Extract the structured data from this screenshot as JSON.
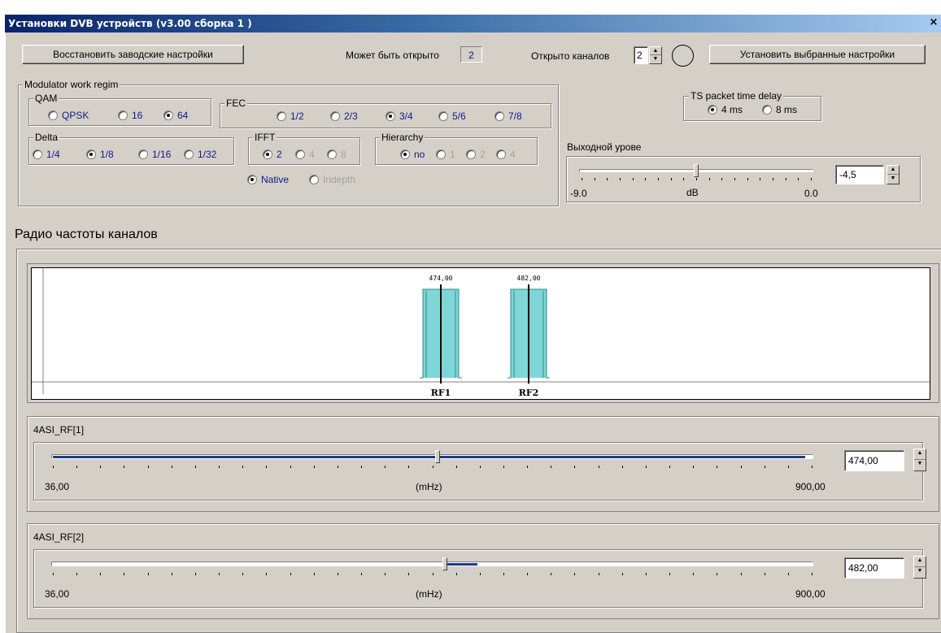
{
  "window": {
    "title": "Установки DVB устройств (v3.00 сборка  1 )",
    "close_glyph": "×"
  },
  "top": {
    "restore_button": "Восстановить заводские настройки",
    "can_open_label": "Может быть открыто",
    "can_open_value": "2",
    "opened_label": "Открыто каналов",
    "opened_value": "2",
    "apply_button": "Установить выбранные настройки"
  },
  "modulator": {
    "title": "Modulator work regim",
    "qam": {
      "title": "QAM",
      "options": [
        "QPSK",
        "16",
        "64"
      ],
      "selected": "64"
    },
    "fec": {
      "title": "FEC",
      "options": [
        "1/2",
        "2/3",
        "3/4",
        "5/6",
        "7/8"
      ],
      "selected": "3/4"
    },
    "delta": {
      "title": "Delta",
      "options": [
        "1/4",
        "1/8",
        "1/16",
        "1/32"
      ],
      "selected": "1/8"
    },
    "ifft": {
      "title": "IFFT",
      "options": [
        "2",
        "4",
        "8"
      ],
      "selected": "2"
    },
    "hierarchy": {
      "title": "Hierarchy",
      "options": [
        "no",
        "1",
        "2",
        "4"
      ],
      "selected": "no"
    },
    "interleave": {
      "options": [
        "Native",
        "Indepth"
      ],
      "selected": "Native"
    }
  },
  "ts_delay": {
    "title": "TS packet time delay",
    "options": [
      "4 ms",
      "8 ms"
    ],
    "selected": "4 ms"
  },
  "output_level": {
    "label": "Выходной урове",
    "min": "-9.0",
    "unit": "dB",
    "max": "0.0",
    "value": "-4,5",
    "level": -4.5
  },
  "rf_section": {
    "title": "Радио частоты каналов"
  },
  "spectrum": {
    "channels": [
      {
        "name": "RF1",
        "freq_label": "474,00",
        "freq": 474
      },
      {
        "name": "RF2",
        "freq_label": "482,00",
        "freq": 482
      }
    ]
  },
  "rf_sliders": [
    {
      "title": "4ASI_RF[1]",
      "min": "36,00",
      "unit": "(mHz)",
      "max": "900,00",
      "value": "474,00",
      "freq": 474
    },
    {
      "title": "4ASI_RF[2]",
      "min": "36,00",
      "unit": "(mHz)",
      "max": "900,00",
      "value": "482,00",
      "freq": 482
    }
  ],
  "colors": {
    "title_bar": "#0a246a",
    "face": "#d4d0c8",
    "spectrum_fill": "#7fd6d6",
    "slider_fill": "#1f3a8a"
  }
}
